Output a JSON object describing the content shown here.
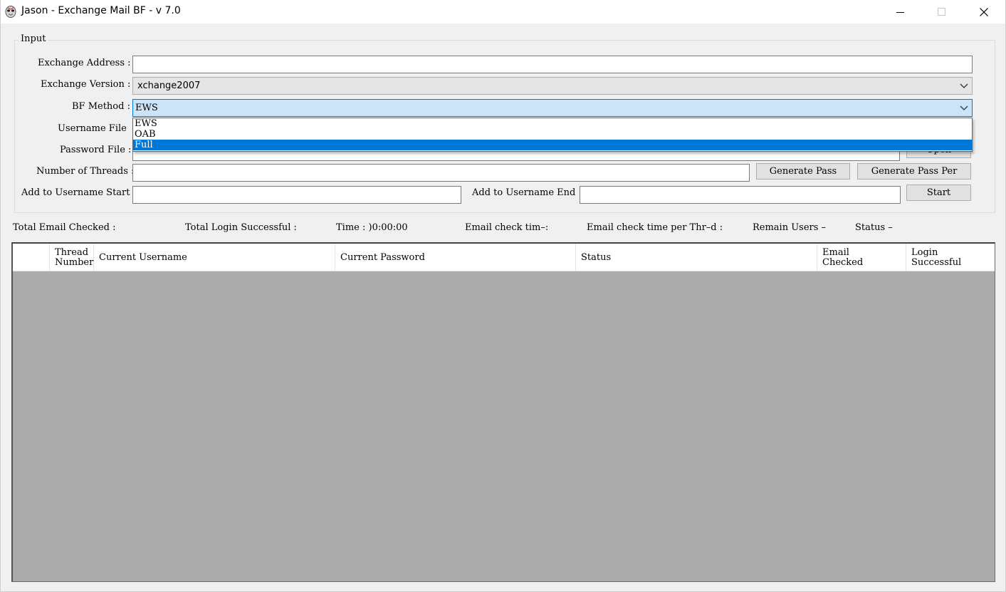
{
  "window": {
    "title": "Jason - Exchange Mail BF - v 7.0"
  },
  "input_group": {
    "legend": "Input",
    "exchange_address": {
      "label": "Exchange Address :",
      "value": ""
    },
    "exchange_version": {
      "label": "Exchange Version :",
      "value": "xchange2007"
    },
    "bf_method": {
      "label": "BF Method :",
      "value": "EWS",
      "options": [
        "EWS",
        "OAB",
        "Full"
      ],
      "highlighted": "Full"
    },
    "username_file": {
      "label": "Username File",
      "value": ""
    },
    "password_file": {
      "label": "Password File :",
      "value": "",
      "open_button": "Open"
    },
    "number_of_threads": {
      "label": "Number of Threads :",
      "value": ""
    },
    "generate_pass_button": "Generate Pass",
    "generate_pass_per_button": "Generate Pass Per",
    "add_to_username_start": {
      "label": "Add to Username Start :",
      "value": ""
    },
    "add_to_username_end": {
      "label": "Add to Username End :",
      "value": ""
    },
    "start_button": "Start"
  },
  "status_bar": {
    "total_email_checked": "Total Email Checked :",
    "total_login_successful": "Total Login Successful :",
    "time": "Time : )0:00:00",
    "email_check_time": "Email check tim–:",
    "email_check_time_per_thread": "Email check time per Thr–d :",
    "remain_users": "Remain Users –",
    "status": "Status –"
  },
  "grid": {
    "columns": [
      {
        "line1": "",
        "line2": ""
      },
      {
        "line1": "Thread",
        "line2": "Number"
      },
      {
        "line1": "Current Username",
        "line2": ""
      },
      {
        "line1": "Current Password",
        "line2": ""
      },
      {
        "line1": "Status",
        "line2": ""
      },
      {
        "line1": "Email",
        "line2": "Checked"
      },
      {
        "line1": "Login",
        "line2": "Successful"
      }
    ],
    "rows": []
  }
}
